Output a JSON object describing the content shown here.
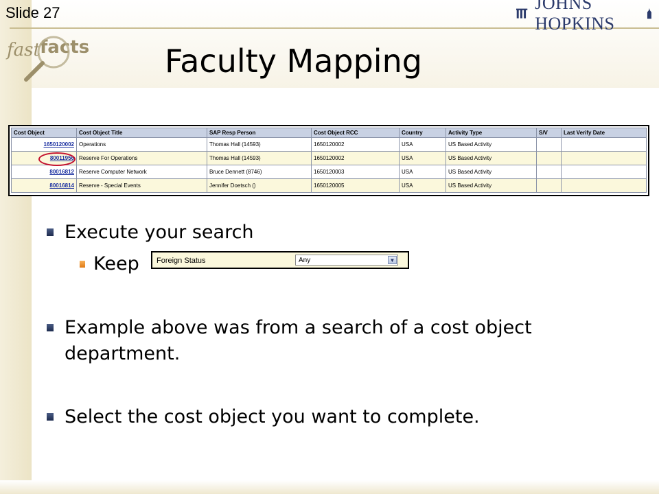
{
  "slide": {
    "number_label": "Slide 27",
    "title": "Faculty Mapping",
    "logo_text": "JOHNS HOPKINS",
    "brand_fast": "fast",
    "brand_facts": "facts"
  },
  "table": {
    "headers": [
      "Cost Object",
      "Cost Object Title",
      "SAP Resp Person",
      "Cost Object RCC",
      "Country",
      "Activity Type",
      "S/V",
      "Last Verify Date"
    ],
    "rows": [
      [
        "1650120002",
        "Operations",
        "Thomas Hall (14593)",
        "1650120002",
        "USA",
        "US Based Activity",
        "",
        ""
      ],
      [
        "80011956",
        "Reserve For Operations",
        "Thomas Hall (14593)",
        "1650120002",
        "USA",
        "US Based Activity",
        "",
        ""
      ],
      [
        "80016812",
        "Reserve Computer Network",
        "Bruce Dennett (8746)",
        "1650120003",
        "USA",
        "US Based Activity",
        "",
        ""
      ],
      [
        "80016814",
        "Reserve - Special Events",
        "Jennifer Doetsch ()",
        "1650120005",
        "USA",
        "US Based Activity",
        "",
        ""
      ]
    ]
  },
  "bullets": {
    "b1": "Execute your search",
    "b1_sub": "Keep",
    "b2_line1": "Example above was from a search of a cost object",
    "b2_line2": "department.",
    "b3": "Select the cost object you want to complete."
  },
  "foreign_status": {
    "label": "Foreign Status",
    "value": "Any"
  },
  "colors": {
    "header_bg": "#c8d1e3",
    "row_alt_bg": "#fbf8dc",
    "link": "#1a2fa0",
    "highlight_circle": "#c4122f"
  },
  "icons": [
    "jh-logo-icon",
    "magnifier-icon",
    "chevron-down-icon"
  ]
}
